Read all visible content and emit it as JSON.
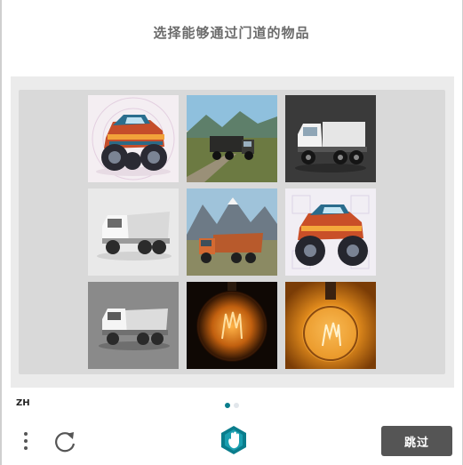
{
  "challenge": {
    "prompt": "选择能够通过门道的物品",
    "tiles": [
      {
        "row": 1,
        "col": 1,
        "subject": "monster truck"
      },
      {
        "row": 1,
        "col": 2,
        "subject": "dump truck"
      },
      {
        "row": 1,
        "col": 3,
        "subject": "dump truck"
      },
      {
        "row": 2,
        "col": 1,
        "subject": "dump truck"
      },
      {
        "row": 2,
        "col": 2,
        "subject": "dump truck"
      },
      {
        "row": 2,
        "col": 3,
        "subject": "monster truck"
      },
      {
        "row": 3,
        "col": 1,
        "subject": "dump truck"
      },
      {
        "row": 3,
        "col": 2,
        "subject": "light bulb"
      },
      {
        "row": 3,
        "col": 3,
        "subject": "light bulb"
      }
    ]
  },
  "footer": {
    "language": "ZH",
    "pagination": {
      "current": 1,
      "total": 2
    },
    "skip_label": "跳过",
    "icons": [
      "menu-dots-icon",
      "refresh-icon",
      "hand-logo-icon"
    ]
  },
  "colors": {
    "accent": "#0a7d8c",
    "skip_button": "#555555",
    "panel": "#ebebeb"
  }
}
